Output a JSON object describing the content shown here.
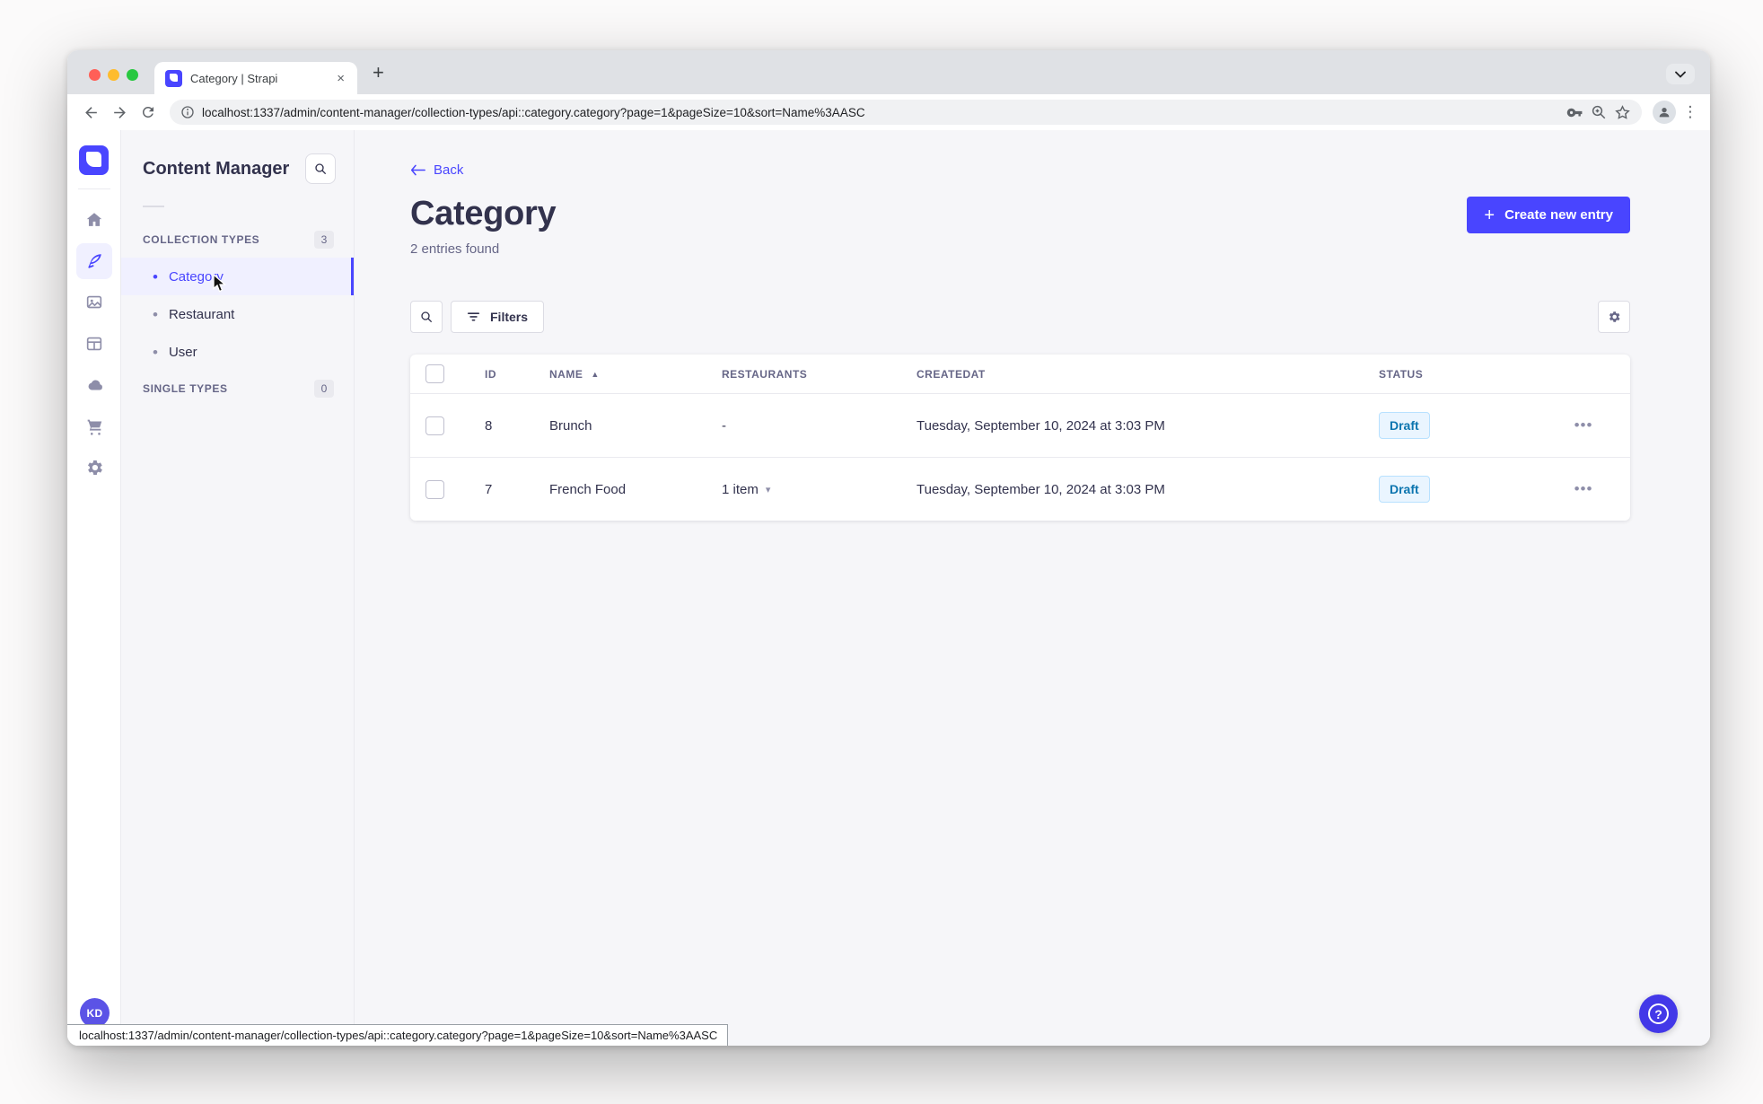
{
  "browser": {
    "tab_title": "Category | Strapi",
    "url": "localhost:1337/admin/content-manager/collection-types/api::category.category?page=1&pageSize=10&sort=Name%3AASC"
  },
  "rail": {
    "avatar_initials": "KD",
    "items": [
      "home",
      "content-manager",
      "media-library",
      "content-type-builder",
      "deploy",
      "marketplace",
      "settings"
    ],
    "active_item": "content-manager"
  },
  "subnav": {
    "title": "Content Manager",
    "sections": [
      {
        "label": "COLLECTION TYPES",
        "count": "3",
        "items": [
          {
            "label": "Category",
            "active": true
          },
          {
            "label": "Restaurant",
            "active": false
          },
          {
            "label": "User",
            "active": false
          }
        ]
      },
      {
        "label": "SINGLE TYPES",
        "count": "0",
        "items": []
      }
    ]
  },
  "main": {
    "back_label": "Back",
    "title": "Category",
    "subtitle": "2 entries found",
    "create_button": "Create new entry",
    "filters_label": "Filters"
  },
  "table": {
    "headers": [
      "ID",
      "NAME",
      "RESTAURANTS",
      "CREATEDAT",
      "STATUS"
    ],
    "sorted_by": "NAME",
    "sort_direction": "ascending",
    "rows": [
      {
        "id": "8",
        "name": "Brunch",
        "restaurants": "-",
        "created_at": "Tuesday, September 10, 2024 at 3:03 PM",
        "status": "Draft"
      },
      {
        "id": "7",
        "name": "French Food",
        "restaurants": "1 item",
        "created_at": "Tuesday, September 10, 2024 at 3:03 PM",
        "status": "Draft"
      }
    ]
  },
  "statusbar": {
    "url": "localhost:1337/admin/content-manager/collection-types/api::category.category?page=1&pageSize=10&sort=Name%3AASC"
  },
  "icons": {
    "close_tab": "×",
    "new_tab": "+",
    "kebab": "⋮",
    "plus": "+",
    "sort_asc": "▲",
    "chevron_down": "▾",
    "more": "•••",
    "bullet": "•",
    "help": "?"
  },
  "colors": {
    "accent": "#4945ff",
    "draft_bg": "#eaf5ff",
    "draft_border": "#b8e1ff",
    "draft_text": "#0c75af",
    "app_bg": "#f6f6f9",
    "text_dark": "#32324d",
    "text_muted": "#666687",
    "traffic_red": "#ff5f57",
    "traffic_yellow": "#febc2e",
    "traffic_green": "#28c840"
  }
}
